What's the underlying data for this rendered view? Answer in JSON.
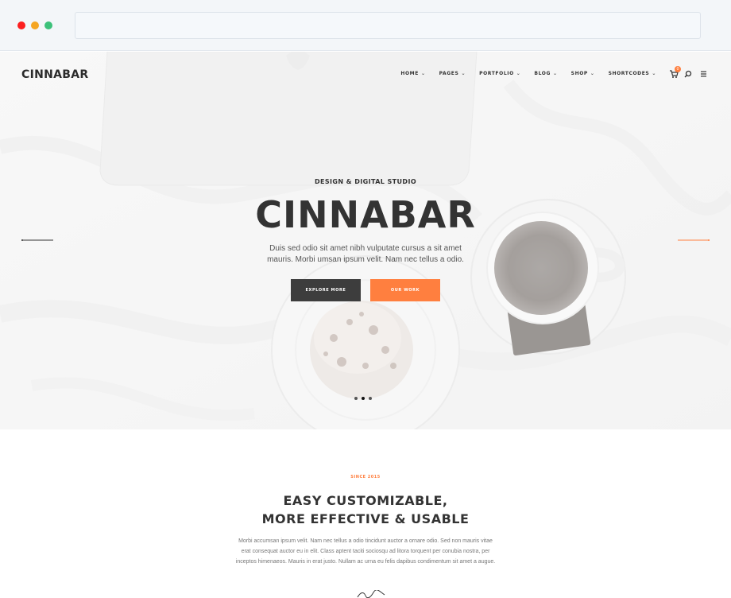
{
  "browser": {
    "window_controls": [
      "close",
      "minimize",
      "maximize"
    ],
    "url": ""
  },
  "header": {
    "logo": "CINNABAR",
    "nav": [
      {
        "label": "HOME"
      },
      {
        "label": "PAGES"
      },
      {
        "label": "PORTFOLIO"
      },
      {
        "label": "BLOG"
      },
      {
        "label": "SHOP"
      },
      {
        "label": "SHORTCODES"
      }
    ],
    "cart_count": "0",
    "icons": [
      "cart-icon",
      "search-icon",
      "menu-icon"
    ]
  },
  "hero": {
    "subtitle": "DESIGN & DIGITAL STUDIO",
    "title": "CINNABAR",
    "text": "Duis sed odio sit amet nibh vulputate cursus a sit amet mauris. Morbi umsan ipsum velit. Nam nec tellus a odio.",
    "primary_button": "EXPLORE MORE",
    "secondary_button": "OUR WORK",
    "slide_count": 3,
    "active_slide": 1
  },
  "intro": {
    "since": "SINCE 2015",
    "title_line1": "EASY CUSTOMIZABLE,",
    "title_line2": "MORE EFFECTIVE & USABLE",
    "text": "Morbi accumsan ipsum velit. Nam nec tellus a odio tincidunt auctor a ornare odio. Sed non  mauris vitae erat consequat auctor eu in elit. Class aptent taciti sociosqu ad litora torquent per conubia nostra, per inceptos himenaeos. Mauris in erat justo. Nullam ac urna eu felis dapibus condimentum sit amet a augue."
  },
  "colors": {
    "accent": "#ff7f3f",
    "dark_button": "#3d3d3d",
    "text_dark": "#333333",
    "text_muted": "#777777"
  }
}
